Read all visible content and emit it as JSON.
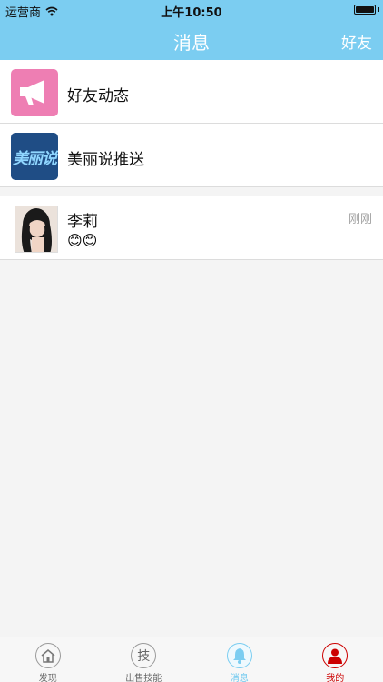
{
  "status_bar": {
    "carrier": "运营商",
    "time": "上午10:50",
    "signal_icon": "wifi-icon",
    "battery_icon": "battery-icon"
  },
  "nav": {
    "title": "消息",
    "right_button": "好友"
  },
  "system_items": [
    {
      "label": "好友动态",
      "icon": "megaphone-icon",
      "color": "#ee7eb3"
    },
    {
      "label": "美丽说推送",
      "icon": "meilishuo-logo",
      "logo_text": "美丽说",
      "color": "#1f4d85"
    }
  ],
  "conversations": [
    {
      "name": "李莉",
      "message": "😊😊",
      "time": "刚刚",
      "avatar": "user-avatar"
    }
  ],
  "tabs": [
    {
      "label": "发现",
      "icon": "home-icon"
    },
    {
      "label": "出售技能",
      "icon": "skill-icon",
      "glyph": "技"
    },
    {
      "label": "消息",
      "icon": "bell-icon",
      "active": true
    },
    {
      "label": "我的",
      "icon": "user-icon"
    }
  ],
  "colors": {
    "primary": "#7bcdf1",
    "tab_active": "#6cc8ef",
    "mine_red": "#cc0000"
  }
}
